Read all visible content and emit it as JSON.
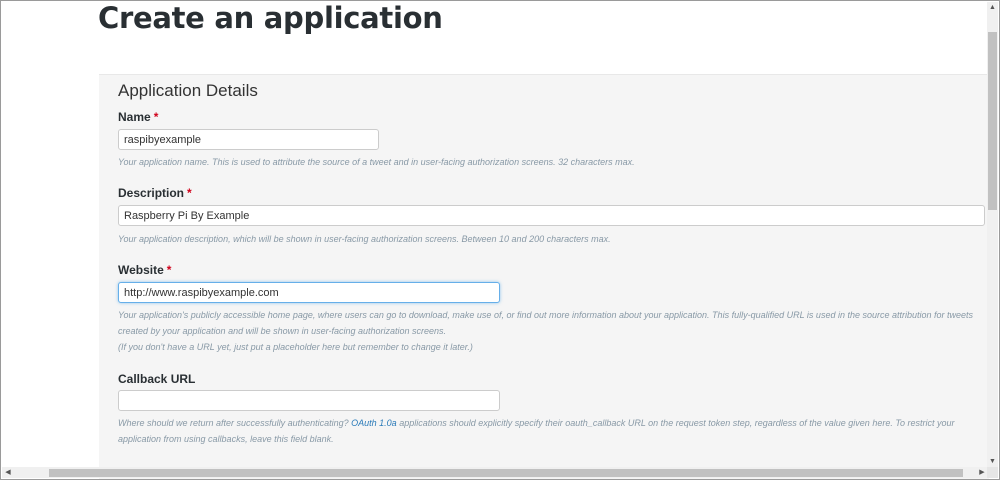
{
  "page": {
    "title": "Create an application"
  },
  "form": {
    "section_title": "Application Details",
    "required_marker": "*",
    "name": {
      "label": "Name",
      "value": "raspibyexample",
      "help": "Your application name. This is used to attribute the source of a tweet and in user-facing authorization screens. 32 characters max."
    },
    "description": {
      "label": "Description",
      "value": "Raspberry Pi By Example",
      "help": "Your application description, which will be shown in user-facing authorization screens. Between 10 and 200 characters max."
    },
    "website": {
      "label": "Website",
      "value": "http://www.raspibyexample.com",
      "help_line1": "Your application's publicly accessible home page, where users can go to download, make use of, or find out more information about your application. This fully-qualified URL is used in the source attribution for tweets",
      "help_line2": "created by your application and will be shown in user-facing authorization screens.",
      "help_line3": "(If you don't have a URL yet, just put a placeholder here but remember to change it later.)"
    },
    "callback": {
      "label": "Callback URL",
      "value": "",
      "help_pre": "Where should we return after successfully authenticating?",
      "help_link": "OAuth 1.0a",
      "help_post": "applications should explicitly specify their oauth_callback URL on the request token step, regardless of the value given here. To restrict your",
      "help_line2": "application from using callbacks, leave this field blank."
    }
  },
  "scrollbars": {
    "up_arrow": "▲",
    "down_arrow": "▼",
    "left_arrow": "◀",
    "right_arrow": "▶"
  },
  "colors": {
    "title": "#292f33",
    "required": "#d0021b",
    "help_text": "#8899a6",
    "link": "#2b7bb9",
    "focus_border": "#66afe9",
    "panel_bg": "#f5f5f5"
  }
}
